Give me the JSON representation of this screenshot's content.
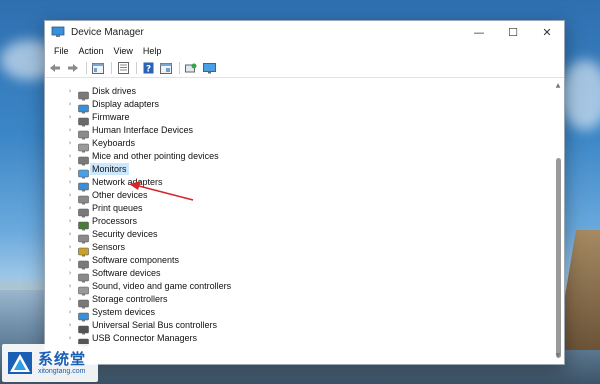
{
  "window": {
    "title": "Device Manager",
    "controls": {
      "minimize": "—",
      "maximize": "☐",
      "close": "✕"
    }
  },
  "menu": [
    "File",
    "Action",
    "View",
    "Help"
  ],
  "toolbar": [
    "back-icon",
    "forward-icon",
    "properties-icon",
    "view-icon",
    "help-icon",
    "action-icon",
    "scan-icon",
    "monitor-icon"
  ],
  "devices": [
    {
      "label": "Disk drives",
      "icon": "disk-icon"
    },
    {
      "label": "Display adapters",
      "icon": "display-icon"
    },
    {
      "label": "Firmware",
      "icon": "firmware-icon"
    },
    {
      "label": "Human Interface Devices",
      "icon": "hid-icon"
    },
    {
      "label": "Keyboards",
      "icon": "keyboard-icon"
    },
    {
      "label": "Mice and other pointing devices",
      "icon": "mouse-icon"
    },
    {
      "label": "Monitors",
      "icon": "monitor-icon",
      "selected": true
    },
    {
      "label": "Network adapters",
      "icon": "network-icon"
    },
    {
      "label": "Other devices",
      "icon": "other-icon"
    },
    {
      "label": "Print queues",
      "icon": "printer-icon"
    },
    {
      "label": "Processors",
      "icon": "processor-icon"
    },
    {
      "label": "Security devices",
      "icon": "security-icon"
    },
    {
      "label": "Sensors",
      "icon": "sensor-icon"
    },
    {
      "label": "Software components",
      "icon": "software-icon"
    },
    {
      "label": "Software devices",
      "icon": "software-device-icon"
    },
    {
      "label": "Sound, video and game controllers",
      "icon": "sound-icon"
    },
    {
      "label": "Storage controllers",
      "icon": "storage-icon"
    },
    {
      "label": "System devices",
      "icon": "system-icon"
    },
    {
      "label": "Universal Serial Bus controllers",
      "icon": "usb-icon"
    },
    {
      "label": "USB Connector Managers",
      "icon": "usb-connector-icon"
    }
  ],
  "colors": {
    "accent": "#0063b1",
    "selection": "#cce8ff",
    "arrow": "#d6262b"
  },
  "watermark": {
    "cn": "系统堂",
    "url": "xitongtang.com"
  }
}
